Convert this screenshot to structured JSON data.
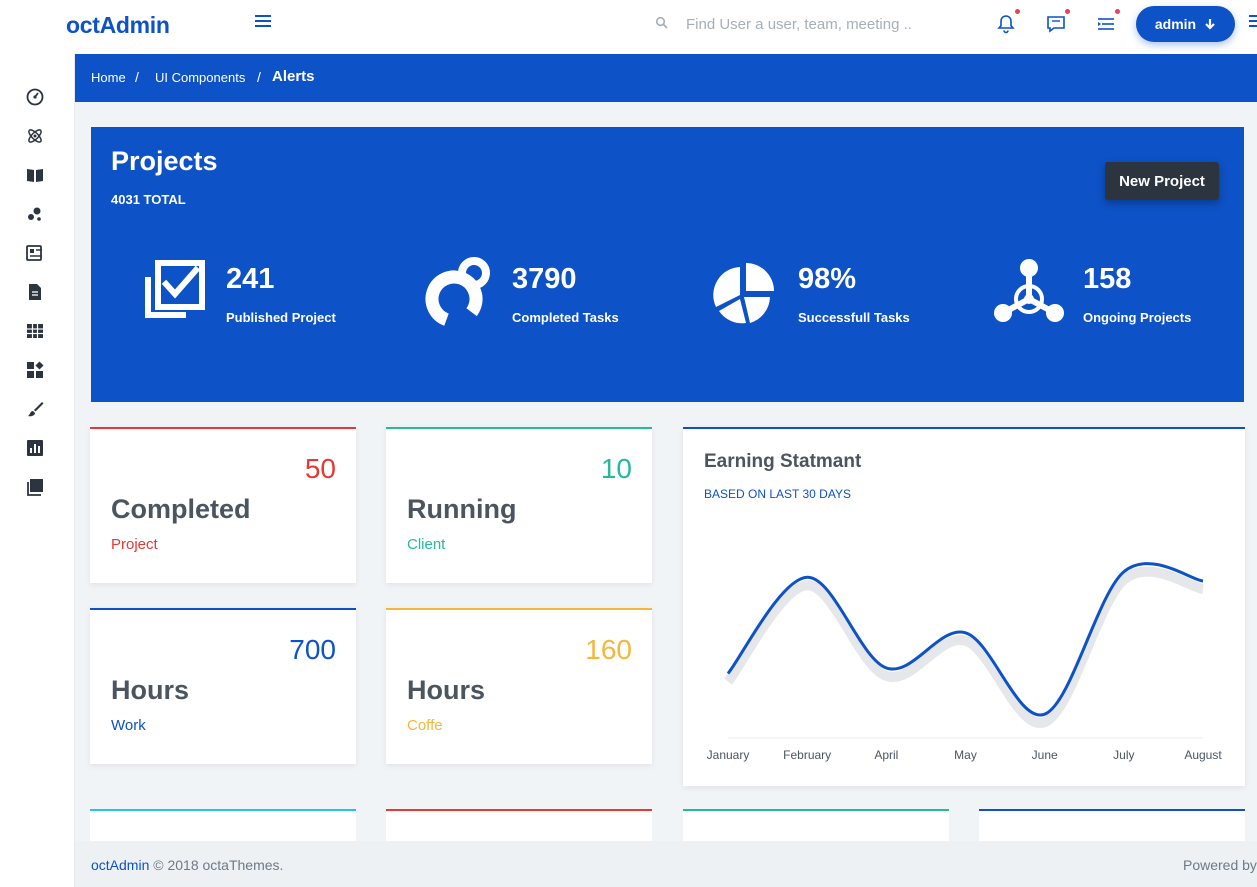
{
  "app": {
    "brand": "octAdmin"
  },
  "search": {
    "placeholder": "Find User a user, team, meeting .."
  },
  "header": {
    "admin_label": "admin"
  },
  "breadcrumb": {
    "home": "Home",
    "sep1": "/",
    "components": "UI Components",
    "sep2": "/",
    "current": "Alerts"
  },
  "projects": {
    "title": "Projects",
    "total": "4031 TOTAL",
    "new_button": "New Project",
    "stats": [
      {
        "value": "241",
        "label": "Published Project",
        "icon": "check-box-icon"
      },
      {
        "value": "3790",
        "label": "Completed Tasks",
        "icon": "donut-icon"
      },
      {
        "value": "98%",
        "label": "Successfull Tasks",
        "icon": "pie-chart-icon"
      },
      {
        "value": "158",
        "label": "Ongoing Projects",
        "icon": "hub-icon"
      }
    ]
  },
  "cards": [
    {
      "number": "50",
      "title": "Completed",
      "subtitle": "Project",
      "color": "#e53935"
    },
    {
      "number": "10",
      "title": "Running",
      "subtitle": "Client",
      "color": "#26b99a"
    },
    {
      "number": "700",
      "title": "Hours",
      "subtitle": "Work",
      "color": "#0d52c6"
    },
    {
      "number": "160",
      "title": "Hours",
      "subtitle": "Coffe",
      "color": "#f4b73c"
    }
  ],
  "earning": {
    "title": "Earning Statmant",
    "subtitle": "BASED ON LAST 30 DAYS"
  },
  "chart_data": {
    "type": "line",
    "title": "Earning Statmant",
    "categories": [
      "January",
      "February",
      "April",
      "May",
      "June",
      "July",
      "August"
    ],
    "series": [
      {
        "values": [
          30,
          82,
          33,
          52,
          8,
          85,
          80
        ]
      }
    ],
    "ylim": [
      0,
      100
    ],
    "grid": false,
    "color": "#0d52c6"
  },
  "bottom_card_colors": [
    "#26c6da",
    "#e53935",
    "#26b99a",
    "#0d52c6"
  ],
  "footer": {
    "brand": "octAdmin",
    "text": "© 2018 octaThemes.",
    "powered": "Powered by"
  }
}
